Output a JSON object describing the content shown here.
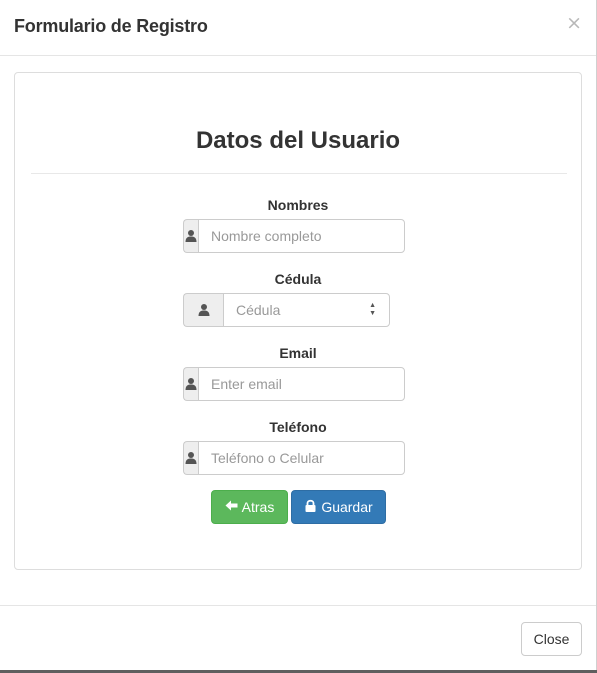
{
  "modal": {
    "title": "Formulario de Registro",
    "close_symbol": "×"
  },
  "form": {
    "heading": "Datos del Usuario",
    "fields": [
      {
        "label": "Nombres",
        "placeholder": "Nombre completo",
        "type": "text",
        "icon": "user-icon"
      },
      {
        "label": "Cédula",
        "placeholder": "Cédula",
        "type": "number",
        "icon": "user-icon"
      },
      {
        "label": "Email",
        "placeholder": "Enter email",
        "type": "email",
        "icon": "user-icon"
      },
      {
        "label": "Teléfono",
        "placeholder": "Teléfono o Celular",
        "type": "tel",
        "icon": "user-icon"
      }
    ],
    "back_button": {
      "label": "Atras",
      "icon": "arrow-left-icon",
      "color": "#5cb85c"
    },
    "save_button": {
      "label": "Guardar",
      "icon": "lock-icon",
      "color": "#337ab7"
    }
  },
  "footer": {
    "close_label": "Close"
  }
}
